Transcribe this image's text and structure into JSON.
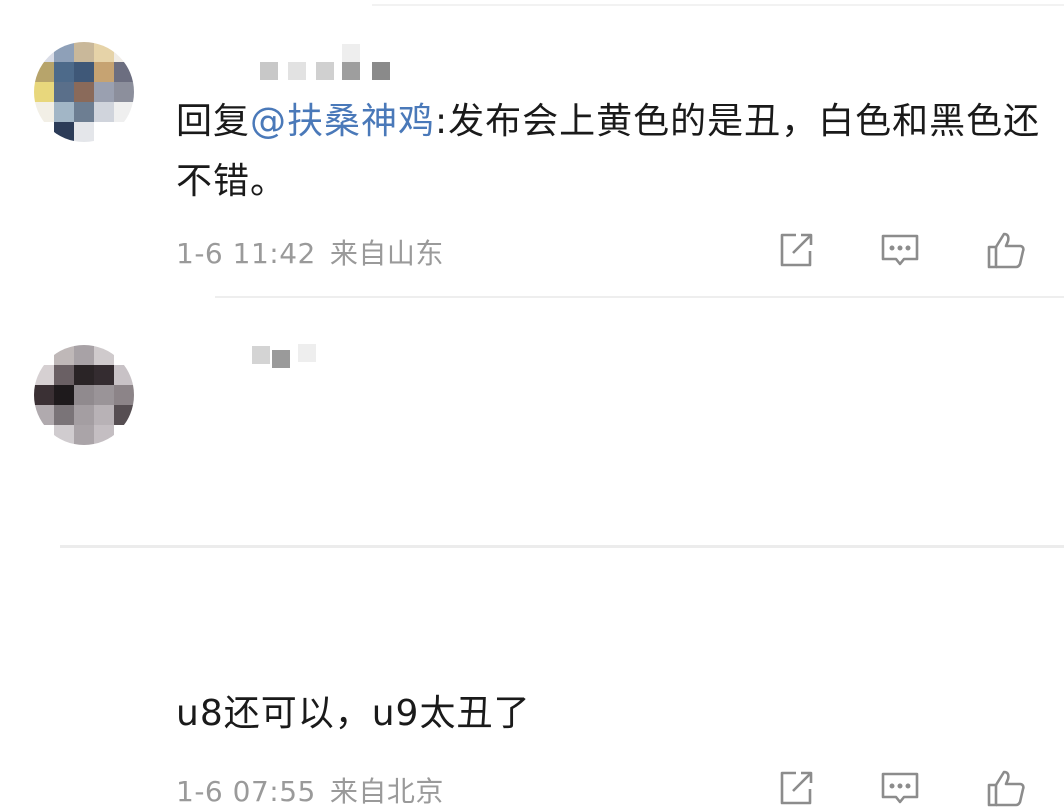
{
  "comments": [
    {
      "username": " ",
      "reply_prefix": "回复",
      "mention": "@扶桑神鸡",
      "text": ":发布会上黄色的是丑，白色和黑色还不错。",
      "time": "1-6 11:42",
      "location": "来自山东",
      "icons": [
        "share-icon",
        "comment-icon",
        "like-icon"
      ]
    },
    {
      "username": " ",
      "text": "u8还可以，u9太丑了",
      "time": "1-6 07:55",
      "location": "来自北京",
      "icons": [
        "share-icon",
        "comment-icon",
        "like-icon"
      ]
    }
  ],
  "colors": {
    "mention": "#4a79b9",
    "body_text": "#1a1a1a",
    "meta_text": "#9a9a9a"
  }
}
